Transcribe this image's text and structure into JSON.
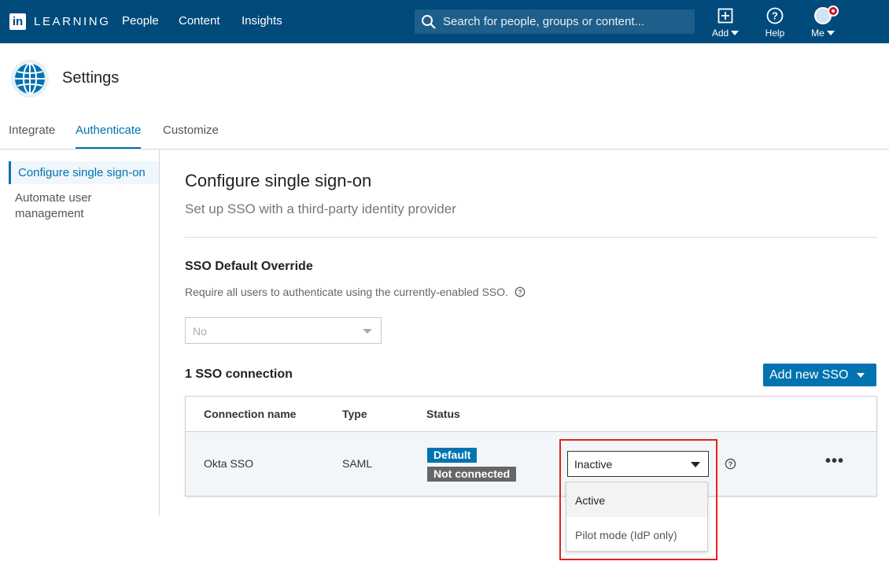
{
  "app": {
    "brand_mark": "in",
    "brand_text": "LEARNING"
  },
  "topnav": {
    "links": [
      "People",
      "Content",
      "Insights"
    ],
    "search_placeholder": "Search for people, groups or content...",
    "add_label": "Add",
    "help_label": "Help",
    "me_label": "Me"
  },
  "header": {
    "title": "Settings"
  },
  "tabs": [
    "Integrate",
    "Authenticate",
    "Customize"
  ],
  "active_tab": "Authenticate",
  "sidebar": {
    "items": [
      "Configure single sign-on",
      "Automate user management"
    ]
  },
  "main": {
    "title": "Configure single sign-on",
    "subtitle": "Set up SSO with a third-party identity provider",
    "override_heading": "SSO Default Override",
    "override_desc": "Require all users to authenticate using the currently-enabled SSO.",
    "override_value": "No",
    "connection_count": "1 SSO connection",
    "add_button": "Add new SSO"
  },
  "table": {
    "headers": [
      "Connection name",
      "Type",
      "Status"
    ],
    "rows": [
      {
        "name": "Okta SSO",
        "type": "SAML",
        "badges": [
          "Default",
          "Not connected"
        ],
        "status_select": "Inactive"
      }
    ]
  },
  "status_dropdown": {
    "options": [
      "Active",
      "Pilot mode (IdP only)"
    ],
    "hovered": "Active"
  },
  "colors": {
    "nav_bg": "#004b7c",
    "accent": "#0073b1",
    "highlight": "#e0241b"
  }
}
